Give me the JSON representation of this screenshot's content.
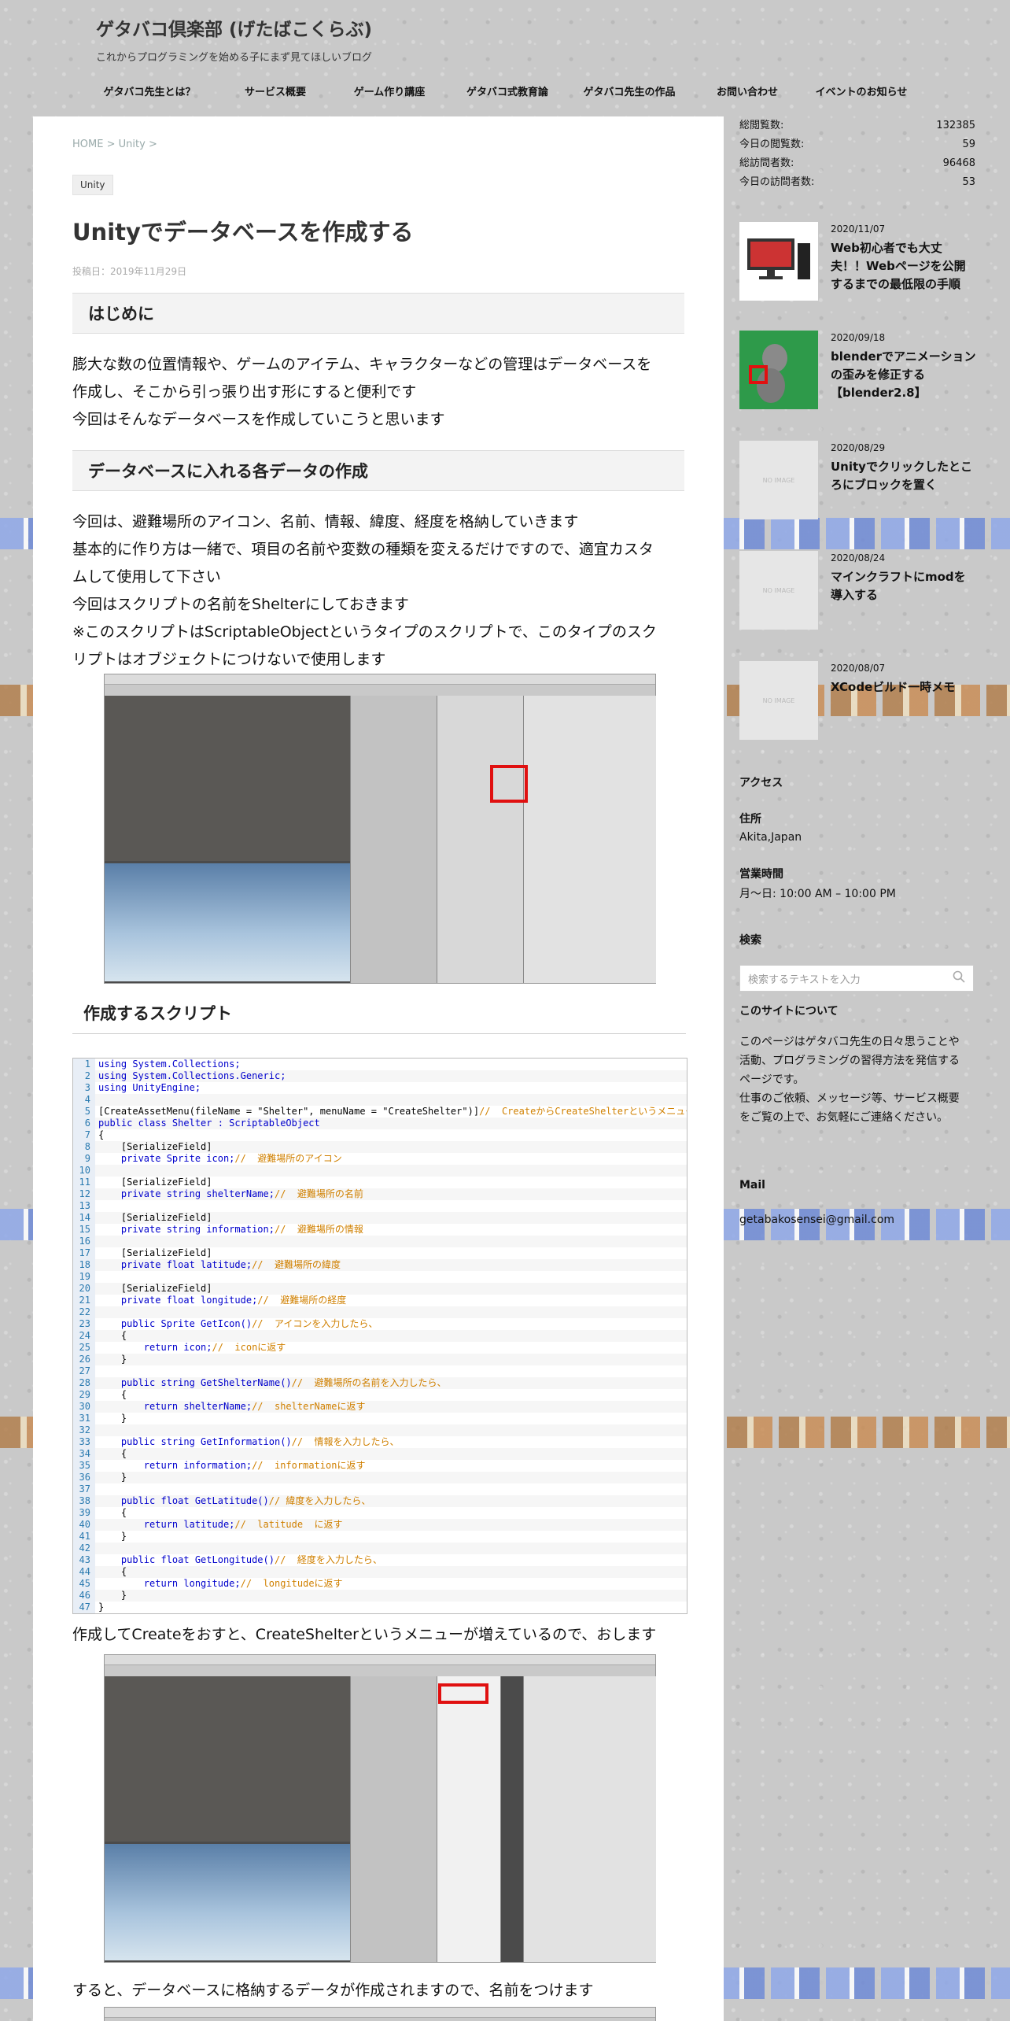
{
  "site": {
    "title": "ゲタバコ倶楽部 (げたばこくらぶ)",
    "description": "これからプログラミングを始める子にまず見てほしいブログ"
  },
  "nav": [
    "ゲタバコ先生とは？",
    "サービス概要",
    "ゲーム作り講座",
    "ゲタバコ式教育論",
    "ゲタバコ先生の作品",
    "お問い合わせ",
    "イベントのお知らせ"
  ],
  "breadcrumb": {
    "home": "HOME",
    "sep1": ">",
    "category": "Unity",
    "sep2": ">"
  },
  "post": {
    "tag": "Unity",
    "title": "Unityでデータベースを作成する",
    "date": "投稿日：2019年11月29日",
    "h2_intro": "はじめに",
    "intro_lines": [
      "膨大な数の位置情報や、ゲームのアイテム、キャラクターなどの管理はデータベースを",
      "作成し、そこから引っ張り出す形にすると便利です",
      "今回はそんなデータベースを作成していこうと思います"
    ],
    "h2_data": "データベースに入れる各データの作成",
    "data_lines": [
      "今回は、避難場所のアイコン、名前、情報、緯度、経度を格納していきます",
      "基本的に作り方は一緒で、項目の名前や変数の種類を変えるだけですので、適宜カスタ",
      "ムして使用して下さい",
      "今回はスクリプトの名前をShelterにしておきます",
      "※このスクリプトはScriptableObjectというタイプのスクリプトで、このタイプのスク",
      "リプトはオブジェクトにつけないで使用します"
    ],
    "h3_script": "作成するスクリプト",
    "code": [
      "using System.Collections;",
      "using System.Collections.Generic;",
      "using UnityEngine;",
      "",
      "[CreateAssetMenu(fileName = \"Shelter\", menuName = \"CreateShelter\")]//  CreateからCreateShelterというメニューを",
      "public class Shelter : ScriptableObject",
      "{",
      "    [SerializeField]",
      "    private Sprite icon;//  避難場所のアイコン",
      "",
      "    [SerializeField]",
      "    private string shelterName;//  避難場所の名前",
      "",
      "    [SerializeField]",
      "    private string information;//  避難場所の情報",
      "",
      "    [SerializeField]",
      "    private float latitude;//  避難場所の緯度",
      "",
      "    [SerializeField]",
      "    private float longitude;//  避難場所の経度",
      "",
      "    public Sprite GetIcon()//  アイコンを入力したら、",
      "    {",
      "        return icon;//  iconに返す",
      "    }",
      "",
      "    public string GetShelterName()//  避難場所の名前を入力したら、",
      "    {",
      "        return shelterName;//  shelterNameに返す",
      "    }",
      "",
      "    public string GetInformation()//  情報を入力したら、",
      "    {",
      "        return information;//  informationに返す",
      "    }",
      "",
      "    public float GetLatitude()// 緯度を入力したら、",
      "    {",
      "        return latitude;//  latitude  に返す",
      "    }",
      "",
      "    public float GetLongitude()//  経度を入力したら、",
      "    {",
      "        return longitude;//  longitudeに返す",
      "    }",
      "}"
    ],
    "after_code": "作成してCreateをおすと、CreateShelterというメニューが増えているので、おします",
    "after_shot": "すると、データベースに格納するデータが作成されますので、名前をつけます"
  },
  "sidebar": {
    "stats": [
      {
        "label": "総閲覧数:",
        "value": "132385"
      },
      {
        "label": "今日の閲覧数:",
        "value": "59"
      },
      {
        "label": "総訪問者数:",
        "value": "96468"
      },
      {
        "label": "今日の訪問者数:",
        "value": "53"
      }
    ],
    "recent": [
      {
        "date": "2020/11/07",
        "title": "Web初心者でも大丈夫！！Webページを公開するまでの最低限の手順",
        "thumb": ""
      },
      {
        "date": "2020/09/18",
        "title": "blenderでアニメーションの歪みを修正する【blender2.8】",
        "thumb": ""
      },
      {
        "date": "2020/08/29",
        "title": "Unityでクリックしたところにブロックを置く",
        "thumb": "NO IMAGE"
      },
      {
        "date": "2020/08/24",
        "title": "マインクラフトにmodを導入する",
        "thumb": "NO IMAGE"
      },
      {
        "date": "2020/08/07",
        "title": "XCodeビルド一時メモ",
        "thumb": "NO IMAGE"
      }
    ],
    "access": "アクセス",
    "address_title": "住所",
    "address": "Akita,Japan",
    "hours_title": "営業時間",
    "hours": "月～日: 10:00 AM – 10:00 PM",
    "search_title": "検索",
    "search_placeholder": "検索するテキストを入力",
    "about_title": "このサイトについて",
    "about_lines": [
      "このページはゲタバコ先生の日々思うことや",
      "活動、プログラミングの習得方法を発信する",
      "ページです。",
      "仕事のご依頼、メッセージ等、サービス概要",
      "をご覧の上で、お気軽にご連絡ください。"
    ],
    "mail_title": "Mail",
    "mail": "getabakosensei@gmail.com"
  },
  "colors": {
    "accent_red": "#e01010",
    "code_keyword": "#0000cc",
    "code_comment": "#d08000"
  }
}
